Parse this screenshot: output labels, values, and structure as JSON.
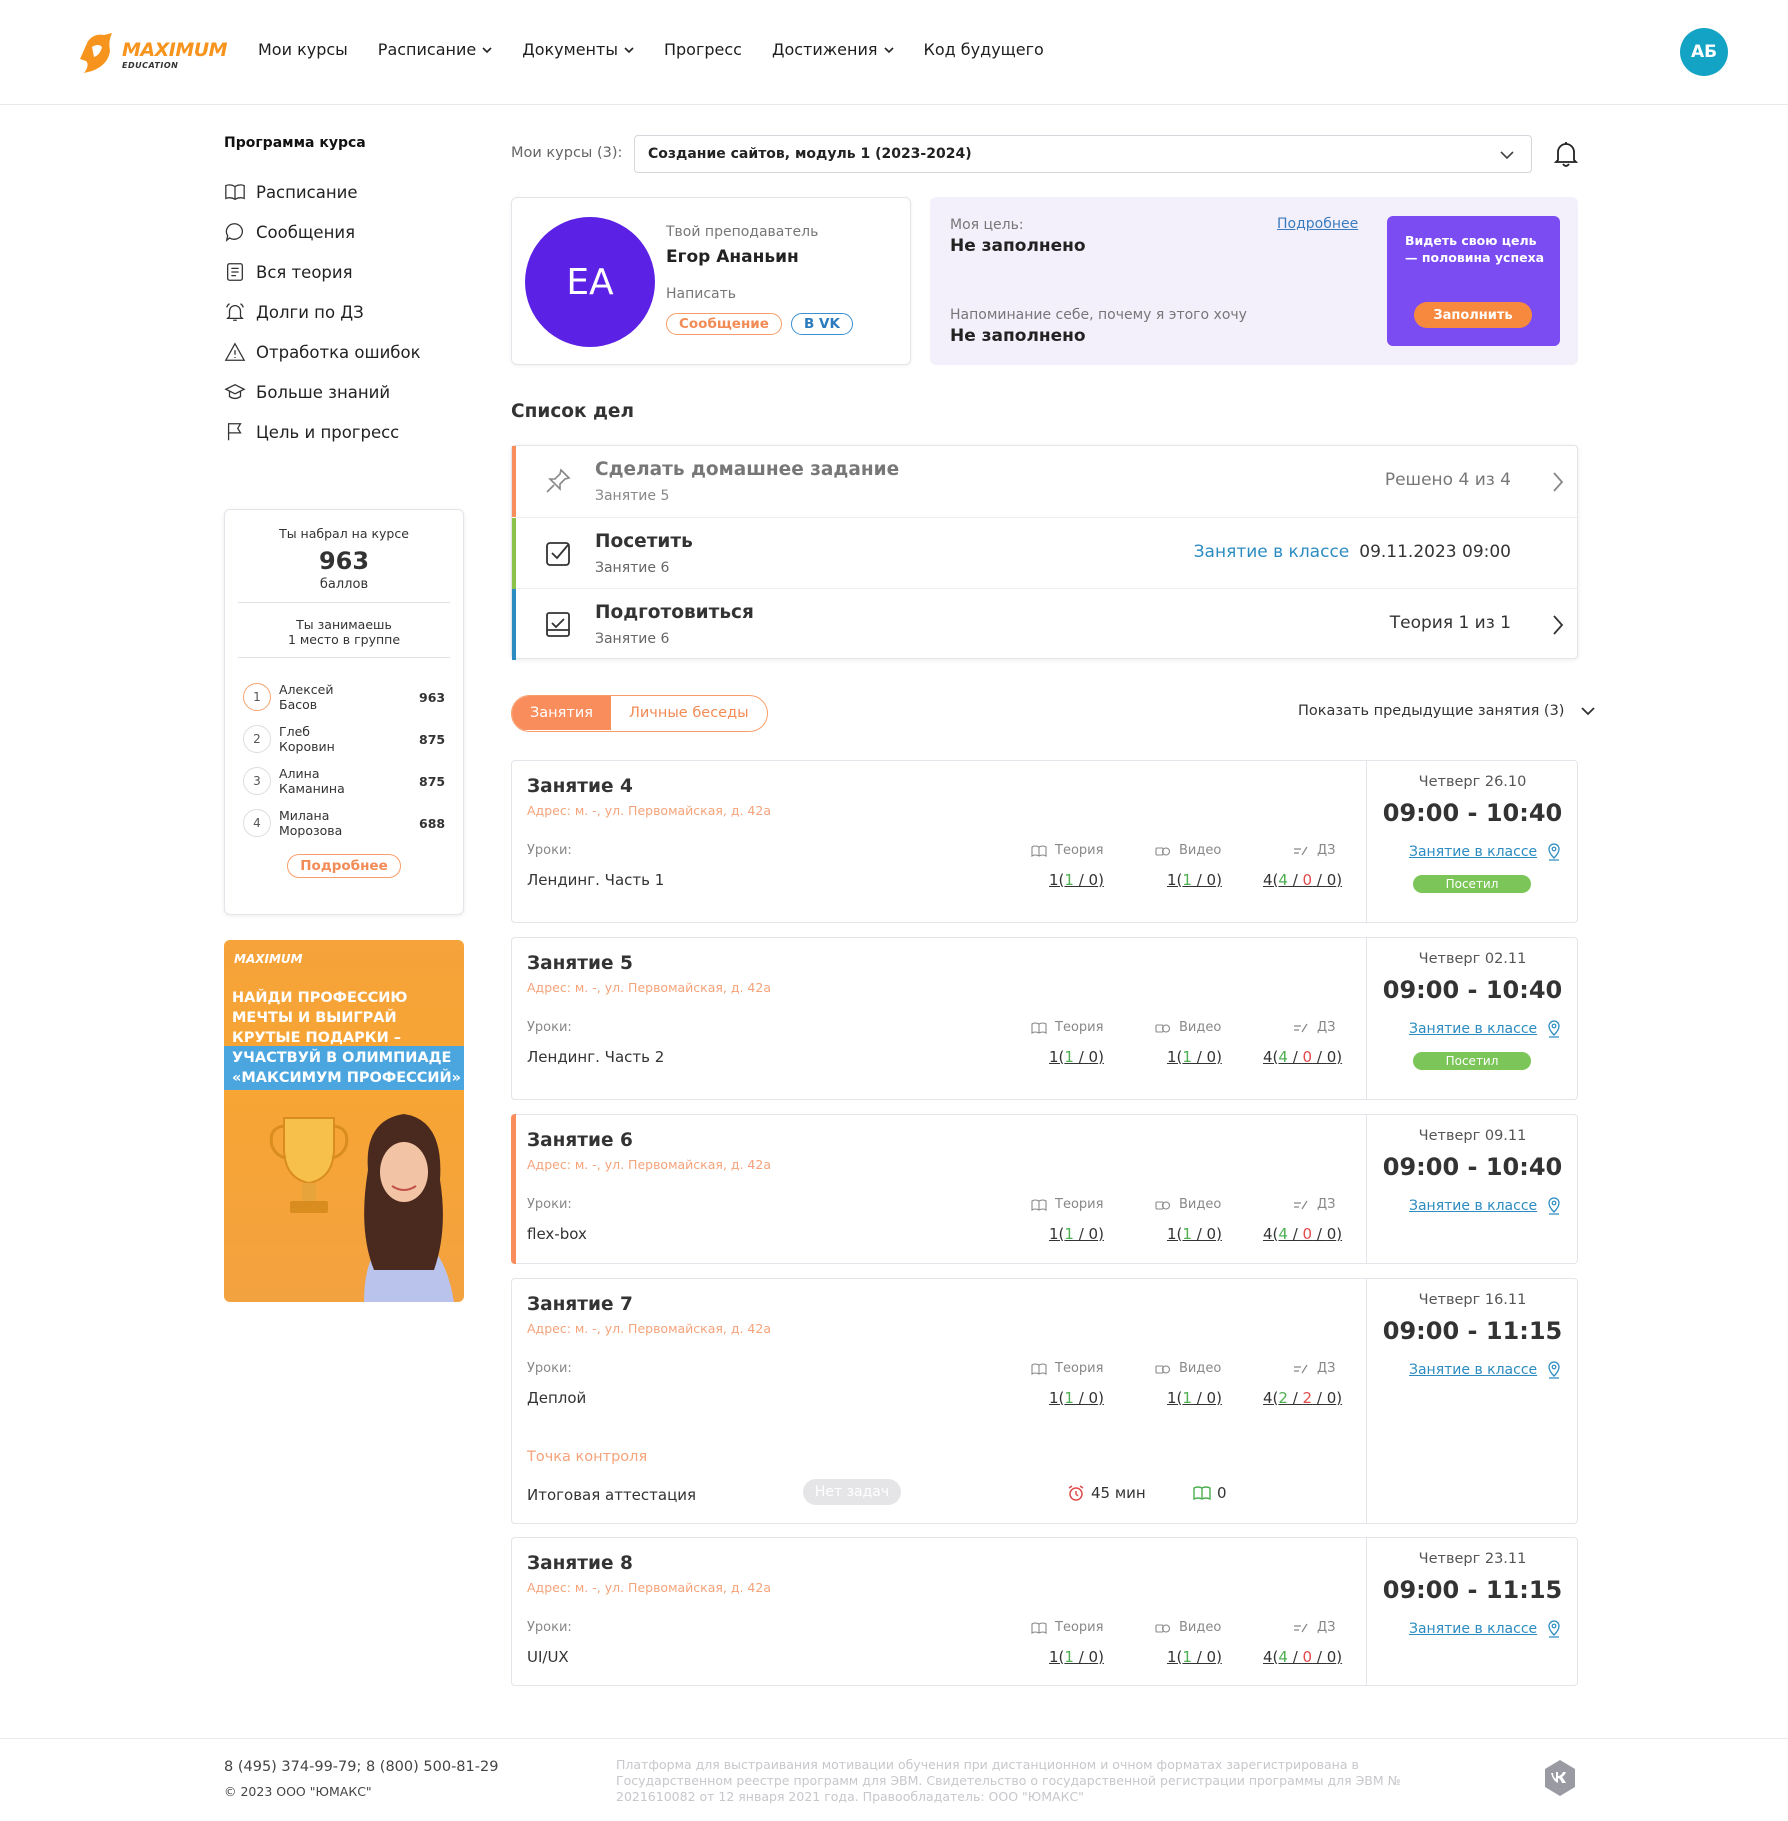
{
  "header": {
    "logo_word": "MAXIMUM",
    "logo_sub": "EDUCATION",
    "nav": [
      "Мои курсы",
      "Расписание",
      "Документы",
      "Прогресс",
      "Достижения",
      "Код будущего"
    ],
    "avatar_initials": "АБ"
  },
  "sidebar": {
    "title": "Программа курса",
    "items": [
      {
        "label": "Расписание",
        "icon": "book-icon"
      },
      {
        "label": "Сообщения",
        "icon": "chat-bubble-icon"
      },
      {
        "label": "Вся теория",
        "icon": "document-icon"
      },
      {
        "label": "Долги по ДЗ",
        "icon": "bell-alert-icon"
      },
      {
        "label": "Отработка ошибок",
        "icon": "warning-icon"
      },
      {
        "label": "Больше знаний",
        "icon": "graduation-cap-icon"
      },
      {
        "label": "Цель и прогресс",
        "icon": "flag-icon"
      }
    ],
    "score": {
      "top_label": "Ты набрал на курсе",
      "points": "963",
      "unit": "баллов",
      "place": "Ты занимаешь\n1 место в группе",
      "leaders": [
        {
          "rank": "1",
          "name": "Алексей\nБасов",
          "points": "963"
        },
        {
          "rank": "2",
          "name": "Глеб\nКоровин",
          "points": "875"
        },
        {
          "rank": "3",
          "name": "Алина\nКаманина",
          "points": "875"
        },
        {
          "rank": "4",
          "name": "Милана\nМорозова",
          "points": "688"
        }
      ],
      "more": "Подробнее"
    },
    "promo": {
      "logo": "MAXIMUM",
      "text": "Найди профессию мечты и выиграй крутые подарки – участвуй в олимпиаде «Максимум профессий»"
    }
  },
  "main": {
    "my_courses_label": "Мои курсы (3):",
    "course_selected": "Создание сайтов, модуль 1 (2023-2024)",
    "teacher": {
      "label": "Твой преподаватель",
      "name": "Егор Ананьин",
      "initials": "ЕА",
      "write_label": "Написать",
      "msg_button": "Сообщение",
      "vk_button": "В VK"
    },
    "goal": {
      "label1": "Моя цель:",
      "value1": "Не заполнено",
      "more": "Подробнее",
      "label2": "Напоминание себе, почему я этого хочу",
      "value2": "Не заполнено",
      "promo_text": "Видеть свою цель\n— половина успеха",
      "promo_button": "Заполнить"
    },
    "todo_title": "Список дел",
    "todos": [
      {
        "title": "Сделать домашнее задание",
        "sub": "Занятие 5",
        "link": "",
        "right": "Решено 4 из 4",
        "color": "#f98d5c",
        "icon": "pin-icon"
      },
      {
        "title": "Посетить",
        "sub": "Занятие 6",
        "link": "Занятие в классе",
        "right": "09.11.2023 09:00",
        "color": "#8bc34a",
        "icon": "checkbox-icon"
      },
      {
        "title": "Подготовиться",
        "sub": "Занятие 6",
        "link": "",
        "right": "Теория 1 из 1",
        "color": "#2c8cc2",
        "icon": "clipboard-icon"
      }
    ],
    "tabs": [
      "Занятия",
      "Личные беседы"
    ],
    "show_prev": "Показать предыдущие занятия (3)",
    "col_headers": {
      "lessons": "Уроки:",
      "theory": "Теория",
      "video": "Видео",
      "hw": "ДЗ"
    },
    "lessons": [
      {
        "title": "Занятие 4",
        "addr": "Адрес: м. -, ул. Первомайская, д. 42а",
        "lesson": "Лендинг. Часть 1",
        "theory": [
          "1",
          "1",
          "0"
        ],
        "video": [
          "1",
          "1",
          "0"
        ],
        "hw": [
          "4",
          "4",
          "0",
          "0"
        ],
        "day": "Четверг 26.10",
        "time": "09:00 - 10:40",
        "link": "Занятие в классе",
        "badge": "Посетил"
      },
      {
        "title": "Занятие 5",
        "addr": "Адрес: м. -, ул. Первомайская, д. 42а",
        "lesson": "Лендинг. Часть 2",
        "theory": [
          "1",
          "1",
          "0"
        ],
        "video": [
          "1",
          "1",
          "0"
        ],
        "hw": [
          "4",
          "4",
          "0",
          "0"
        ],
        "day": "Четверг 02.11",
        "time": "09:00 - 10:40",
        "link": "Занятие в классе",
        "badge": "Посетил"
      },
      {
        "title": "Занятие 6",
        "addr": "Адрес: м. -, ул. Первомайская, д. 42а",
        "lesson": "flex-box",
        "theory": [
          "1",
          "1",
          "0"
        ],
        "video": [
          "1",
          "1",
          "0"
        ],
        "hw": [
          "4",
          "4",
          "0",
          "0"
        ],
        "day": "Четверг 09.11",
        "time": "09:00 - 10:40",
        "link": "Занятие в классе",
        "badge": ""
      },
      {
        "title": "Занятие 7",
        "addr": "Адрес: м. -, ул. Первомайская, д. 42а",
        "lesson": "Деплой",
        "theory": [
          "1",
          "1",
          "0"
        ],
        "video": [
          "1",
          "1",
          "0"
        ],
        "hw": [
          "4",
          "2",
          "2",
          "0"
        ],
        "day": "Четверг 16.11",
        "time": "09:00 - 11:15",
        "link": "Занятие в классе",
        "badge": "",
        "checkpoint": {
          "title": "Точка контроля",
          "name": "Итоговая аттестация",
          "badge": "Нет задач",
          "time": "45 мин",
          "books": "0"
        }
      },
      {
        "title": "Занятие 8",
        "addr": "Адрес: м. -, ул. Первомайская, д. 42а",
        "lesson": "UI/UX",
        "theory": [
          "1",
          "1",
          "0"
        ],
        "video": [
          "1",
          "1",
          "0"
        ],
        "hw": [
          "4",
          "4",
          "0",
          "0"
        ],
        "day": "Четверг 23.11",
        "time": "09:00 - 11:15",
        "link": "Занятие в классе",
        "badge": ""
      }
    ]
  },
  "footer": {
    "phone": "8 (495) 374-99-79; 8 (800) 500-81-29",
    "copy": "© 2023 ООО \"ЮМАКС\"",
    "legal": "Платформа для выстраивания мотивации обучения при дистанционном и очном форматах зарегистрирована в Государственном реестре программ для ЭВМ. Свидетельство о государственной регистрации программы для ЭВМ № 2021610082 от 12 января 2021 года. Правообладатель: ООО \"ЮМАКС\""
  },
  "colors": {
    "accent": "#f98d5c",
    "link": "#2c8cc2",
    "teacher_avatar": "#5b21e5",
    "avatar": "#13a3c4",
    "goal_promo": "#7a4cf2"
  }
}
